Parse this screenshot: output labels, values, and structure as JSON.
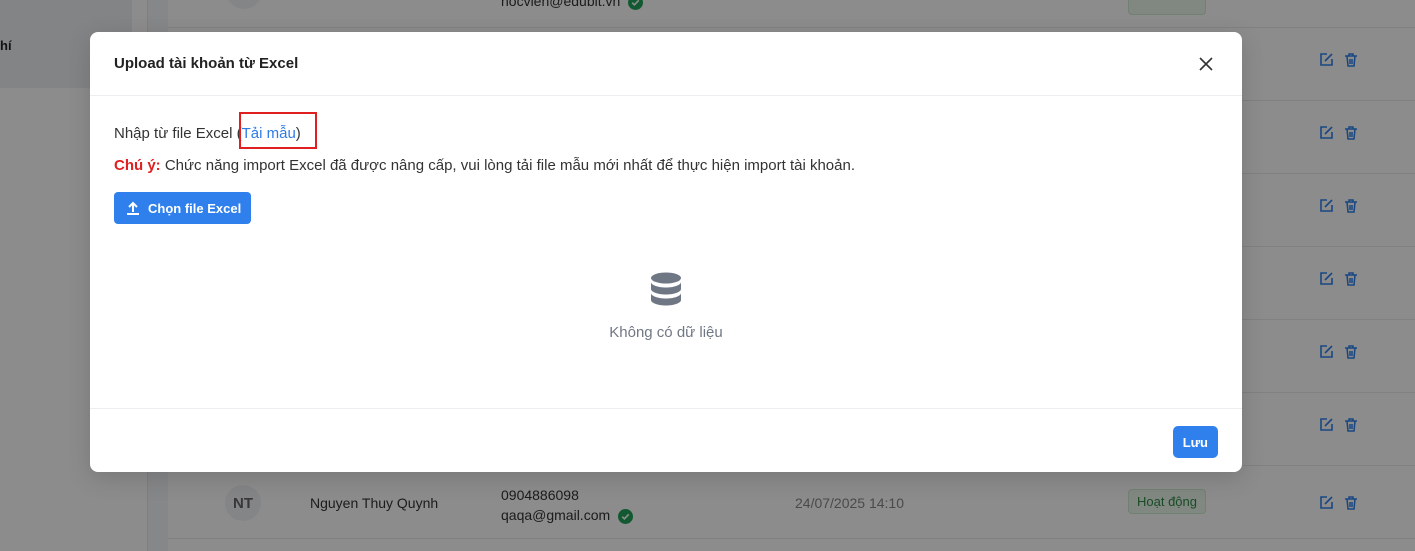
{
  "background": {
    "sidebar_text": "hí",
    "top_row": {
      "email": "hocvien@edubit.vn"
    },
    "visible_row": {
      "initials": "NT",
      "name": "Nguyen Thuy Quynh",
      "phone": "0904886098",
      "email": "qaqa@gmail.com",
      "created": "24/07/2025 14:10",
      "status": "Hoạt động"
    }
  },
  "modal": {
    "title": "Upload tài khoản từ Excel",
    "import_label": "Nhập từ file Excel",
    "open_paren": "(",
    "template_link": "Tải mẫu",
    "close_paren": ")",
    "note_label": "Chú ý:",
    "note_text": " Chức năng import Excel đã được nâng cấp, vui lòng tải file mẫu mới nhất để thực hiện import tài khoản.",
    "upload_button": "Chọn file Excel",
    "empty_text": "Không có dữ liệu",
    "save_button": "Lưu"
  },
  "colors": {
    "primary": "#2f80ed",
    "link": "#2f7be5",
    "warning": "#e02020",
    "status_green": "#2e8b46"
  },
  "icons": [
    "close-icon",
    "upload-icon",
    "database-icon",
    "edit-icon",
    "delete-icon",
    "verified-icon"
  ]
}
